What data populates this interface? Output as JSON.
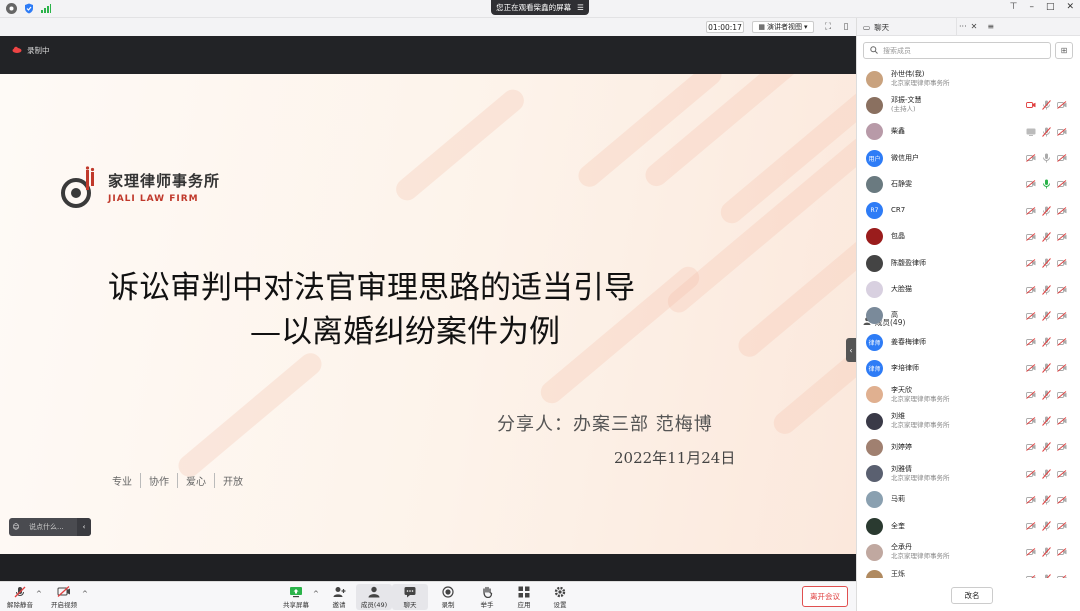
{
  "banner": {
    "text": "您正在观看柴鑫的屏幕"
  },
  "topbar": {
    "timer": "01:00:17",
    "view_mode": "演讲者视图"
  },
  "recording": {
    "label": "录制中"
  },
  "slide": {
    "logo_cn": "家理律师事务所",
    "logo_en": "JIALI LAW FIRM",
    "title_line1": "诉讼审判中对法官审理思路的适当引导",
    "title_line2": "—以离婚纠纷案件为例",
    "sharer": "分享人：办案三部  范梅博",
    "date": "2022年11月24日",
    "tags": [
      "专业",
      "协作",
      "爱心",
      "开放"
    ]
  },
  "chat_input": {
    "placeholder": "说点什么..."
  },
  "toolbar": {
    "unmute": "解除静音",
    "start_video": "开启视频",
    "share_screen": "共享屏幕",
    "invite": "邀请",
    "members": "成员(49)",
    "chat": "聊天",
    "record": "录制",
    "raise_hand": "举手",
    "apps": "应用",
    "settings": "设置",
    "leave": "离开会议"
  },
  "panel": {
    "tab_chat": "聊天",
    "tab_members": "成员(49)",
    "search_placeholder": "搜索成员",
    "rename": "改名",
    "members": [
      {
        "name": "孙世伟(我)",
        "sub": "北京家理律师事务所",
        "avatar_color": "#c9a27e",
        "avatar_text": "",
        "mic": "none",
        "cam": "none"
      },
      {
        "name": "邓振-文慧",
        "sub": "(主持人)",
        "avatar_color": "#8a7060",
        "avatar_text": "",
        "mic": "off",
        "cam": "off",
        "cam_red": true
      },
      {
        "name": "柴鑫",
        "sub": "",
        "avatar_color": "#b89aa8",
        "avatar_text": "",
        "mic": "off",
        "cam": "share"
      },
      {
        "name": "微信用户",
        "sub": "",
        "avatar_color": "#2e7cf6",
        "avatar_text": "用户",
        "mic": "gray",
        "cam": "off"
      },
      {
        "name": "石静雯",
        "sub": "",
        "avatar_color": "#6a7a80",
        "avatar_text": "",
        "mic": "green",
        "cam": "off"
      },
      {
        "name": "CR7",
        "sub": "",
        "avatar_color": "#2e7cf6",
        "avatar_text": "R7",
        "mic": "off",
        "cam": "off"
      },
      {
        "name": "包晶",
        "sub": "",
        "avatar_color": "#9a1c1c",
        "avatar_text": "",
        "mic": "off",
        "cam": "off"
      },
      {
        "name": "陈馥盈律师",
        "sub": "",
        "avatar_color": "#444",
        "avatar_text": "",
        "mic": "off",
        "cam": "off"
      },
      {
        "name": "大脸猫",
        "sub": "",
        "avatar_color": "#d8d0e0",
        "avatar_text": "",
        "mic": "off",
        "cam": "off"
      },
      {
        "name": "高",
        "sub": "",
        "avatar_color": "#7a8a9a",
        "avatar_text": "",
        "mic": "off",
        "cam": "off"
      },
      {
        "name": "姜春梅律师",
        "sub": "",
        "avatar_color": "#2e7cf6",
        "avatar_text": "律师",
        "mic": "off",
        "cam": "off"
      },
      {
        "name": "李培律师",
        "sub": "",
        "avatar_color": "#2e7cf6",
        "avatar_text": "律师",
        "mic": "off",
        "cam": "off"
      },
      {
        "name": "李天欣",
        "sub": "北京家理律师事务所",
        "avatar_color": "#e0b090",
        "avatar_text": "",
        "mic": "off",
        "cam": "off"
      },
      {
        "name": "刘维",
        "sub": "北京家理律师事务所",
        "avatar_color": "#3a3a48",
        "avatar_text": "",
        "mic": "off",
        "cam": "off"
      },
      {
        "name": "刘婷婷",
        "sub": "",
        "avatar_color": "#a08070",
        "avatar_text": "",
        "mic": "off",
        "cam": "off"
      },
      {
        "name": "刘雅倩",
        "sub": "北京家理律师事务所",
        "avatar_color": "#5a6070",
        "avatar_text": "",
        "mic": "off",
        "cam": "off"
      },
      {
        "name": "马莉",
        "sub": "",
        "avatar_color": "#8aa0b0",
        "avatar_text": "",
        "mic": "off",
        "cam": "off"
      },
      {
        "name": "全奎",
        "sub": "",
        "avatar_color": "#2a3a30",
        "avatar_text": "",
        "mic": "off",
        "cam": "off"
      },
      {
        "name": "仝承丹",
        "sub": "北京家理律师事务所",
        "avatar_color": "#c0a8a0",
        "avatar_text": "",
        "mic": "off",
        "cam": "off"
      },
      {
        "name": "王烁",
        "sub": "北京家理律师事务所",
        "avatar_color": "#b08a60",
        "avatar_text": "",
        "mic": "off",
        "cam": "off"
      }
    ]
  },
  "colors": {
    "accent": "#2e7cf6",
    "danger": "#e04040",
    "mic_green": "#2bb34a"
  }
}
